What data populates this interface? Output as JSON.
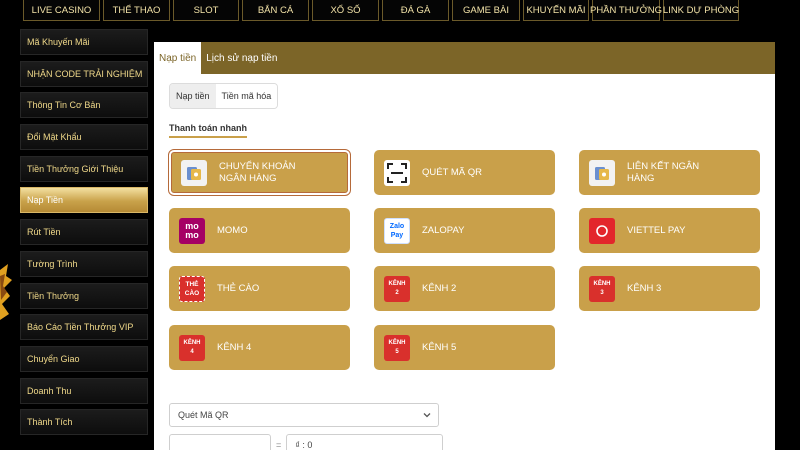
{
  "topnav": [
    {
      "label": "LIVE CASINO"
    },
    {
      "label": "THỂ THAO"
    },
    {
      "label": "SLOT"
    },
    {
      "label": "BẮN CÁ"
    },
    {
      "label": "XỔ SỐ"
    },
    {
      "label": "ĐÁ GÀ"
    },
    {
      "label": "GAME BÀI"
    },
    {
      "label": "KHUYẾN MÃI"
    },
    {
      "label": "PHẦN THƯỞNG"
    },
    {
      "label": "LINK DỰ PHÒNG"
    }
  ],
  "sidebar": {
    "items": [
      {
        "label": "Mã Khuyến Mãi"
      },
      {
        "label": "NHẬN CODE TRẢI NGHIỆM"
      },
      {
        "label": "Thông Tin Cơ Bản"
      },
      {
        "label": "Đổi Mật Khẩu"
      },
      {
        "label": "Tiền Thưởng Giới Thiệu"
      },
      {
        "label": "Nạp Tiền",
        "active": true
      },
      {
        "label": "Rút Tiền"
      },
      {
        "label": "Tường Trình"
      },
      {
        "label": "Tiền Thưởng"
      },
      {
        "label": "Báo Cáo Tiền Thưởng VIP"
      },
      {
        "label": "Chuyển Giao"
      },
      {
        "label": "Doanh Thu"
      },
      {
        "label": "Thành Tích"
      }
    ]
  },
  "panel": {
    "tabs": [
      {
        "label": "Nạp tiền",
        "active": true
      },
      {
        "label": "Lịch sử nạp tiền"
      }
    ],
    "segment": [
      {
        "label": "Nạp tiền",
        "active": true
      },
      {
        "label": "Tiền mã hóa"
      }
    ],
    "section_title": "Thanh toán nhanh",
    "methods": [
      {
        "label": "CHUYỂN KHOẢN\nNGÂN HÀNG",
        "icon": "bank-card-icon",
        "selected": true
      },
      {
        "label": "QUÉT MÃ QR",
        "icon": "qr-scan-icon"
      },
      {
        "label": "LIÊN KẾT NGÂN\nHÀNG",
        "icon": "bank-link-icon"
      },
      {
        "label": "MOMO",
        "icon": "momo-icon",
        "icon_text": "mo\nmo"
      },
      {
        "label": "ZALOPAY",
        "icon": "zalopay-icon",
        "icon_text": "Zalo\nPay"
      },
      {
        "label": "VIETTEL PAY",
        "icon": "viettelpay-icon",
        "icon_text": "viettel"
      },
      {
        "label": "THẺ CÀO",
        "icon": "scratch-card-icon",
        "icon_text": "THẺ\nCÀO"
      },
      {
        "label": "KÊNH 2",
        "icon": "channel-2-icon",
        "icon_text": "KÊNH\n2"
      },
      {
        "label": "KÊNH 3",
        "icon": "channel-3-icon",
        "icon_text": "KÊNH\n3"
      },
      {
        "label": "KÊNH 4",
        "icon": "channel-4-icon",
        "icon_text": "KÊNH\n4"
      },
      {
        "label": "KÊNH 5",
        "icon": "channel-5-icon",
        "icon_text": "KÊNH\n5"
      }
    ],
    "select_value": "Quét Mã QR",
    "amount_placeholder": "",
    "amount_display": "₫ : 0"
  },
  "colors": {
    "gold": "#c9a04a",
    "header_brown": "#7c6528",
    "momo": "#a50064",
    "zalo_blue": "#0068ff",
    "viettel_red": "#e3262b",
    "channel_red": "#d9302c"
  }
}
